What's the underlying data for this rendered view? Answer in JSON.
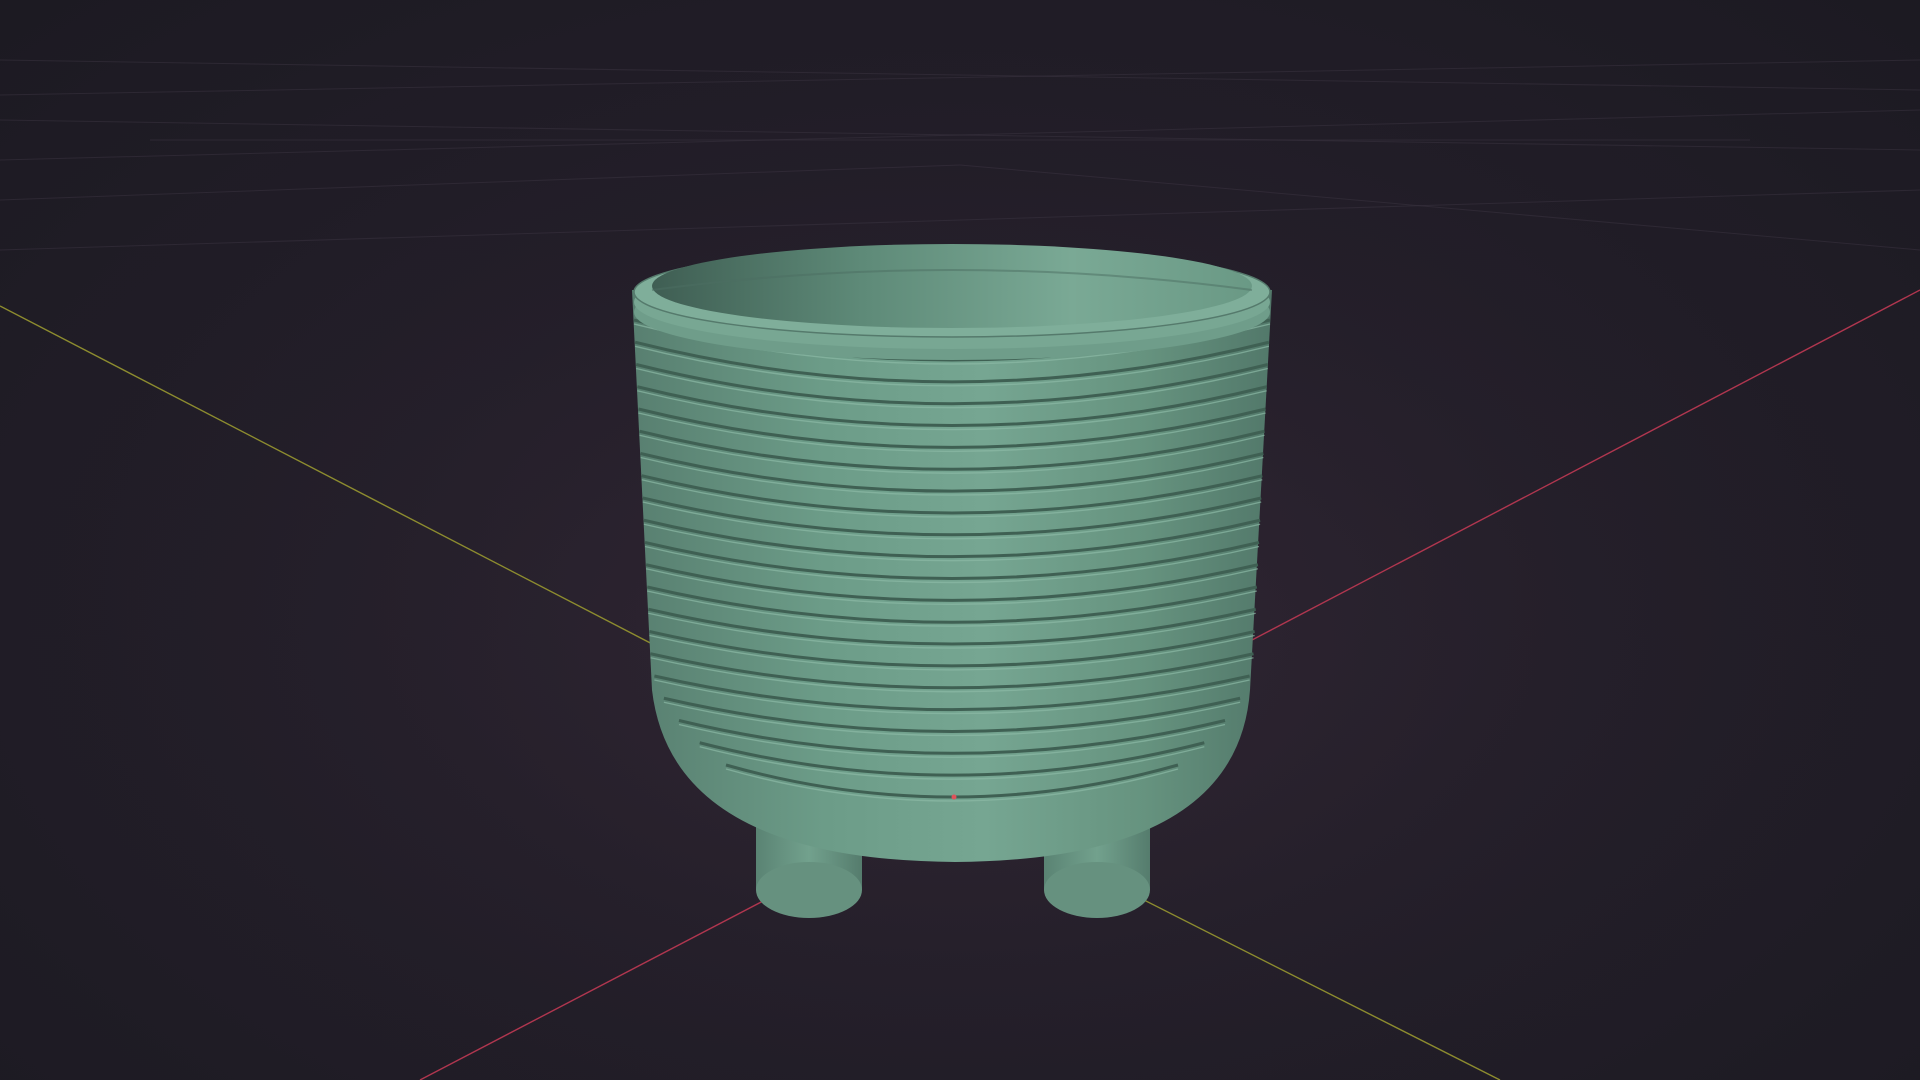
{
  "viewport": {
    "background": "#231e29",
    "x_axis_color": "#b0364f",
    "y_axis_color": "#8d8c2f",
    "grid_color": "#3a3340"
  },
  "object": {
    "type": "plant-pot",
    "color": "#6b9e8a",
    "ridge_count": 21,
    "legs_visible": 2
  },
  "origin_marker_color": "#e0525a"
}
